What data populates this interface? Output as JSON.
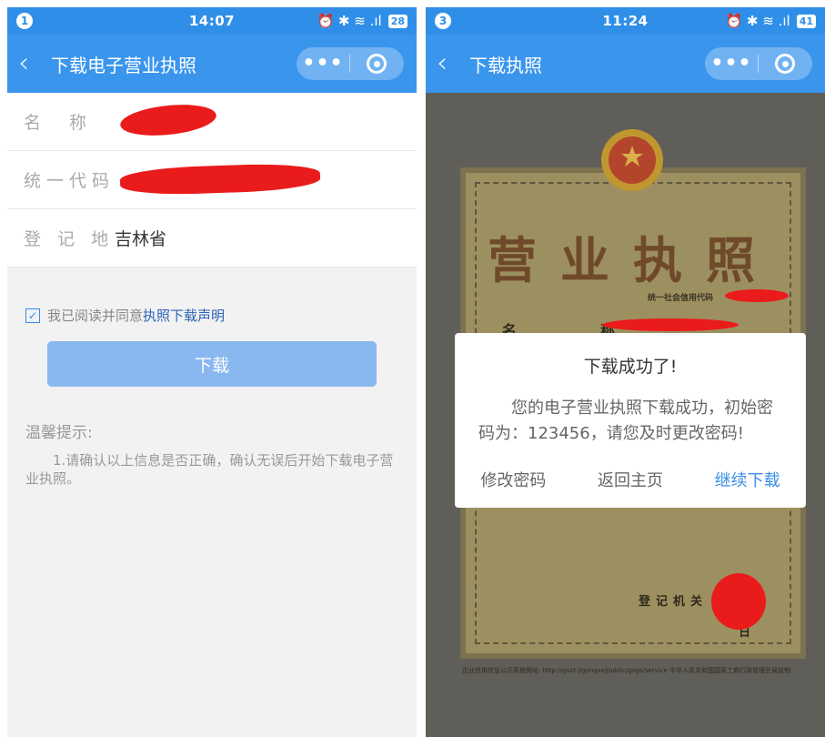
{
  "left": {
    "status": {
      "notif": "1",
      "time": "14:07",
      "battery": "28",
      "icons": "⏰ ✱ ≋ .ıl"
    },
    "nav": {
      "back": "‹",
      "title": "下载电子营业执照",
      "more": "•••"
    },
    "form": [
      {
        "label": "名　称",
        "value": ""
      },
      {
        "label": "统一代码",
        "value": ""
      },
      {
        "label": "登 记 地",
        "value": "吉林省"
      }
    ],
    "agree": {
      "check": "✓",
      "text": "我已阅读并同意 ",
      "link": "执照下载声明"
    },
    "download_button": "下载",
    "tip": {
      "title": "温馨提示:",
      "body": "1.请确认以上信息是否正确，确认无误后开始下载电子营业执照。"
    }
  },
  "right": {
    "status": {
      "notif": "3",
      "time": "11:24",
      "battery": "41",
      "icons": "⏰ ✱ ≋ .ıl"
    },
    "nav": {
      "back": "‹",
      "title": "下载执照",
      "more": "•••"
    },
    "license": {
      "title": "营业执照",
      "code_label": "统一社会信用代码",
      "name_label": "名　称",
      "office_label": "登记机关",
      "date_suffix": "日",
      "footer": "企业信用信息公示系统网址: http://gsxt.jlgongsx/public/gsgs/service 中华人民共和国国家工商行政管理总局监制"
    },
    "dialog": {
      "title": "下载成功了!",
      "message": "您的电子营业执照下载成功，初始密码为：123456，请您及时更改密码!",
      "actions": [
        "修改密码",
        "返回主页",
        "继续下载"
      ]
    }
  },
  "colors": {
    "primary": "#2f8fe8",
    "button_disabled": "#89b8f0",
    "link": "#2a62b8",
    "redaction": "#ea1b1b"
  }
}
